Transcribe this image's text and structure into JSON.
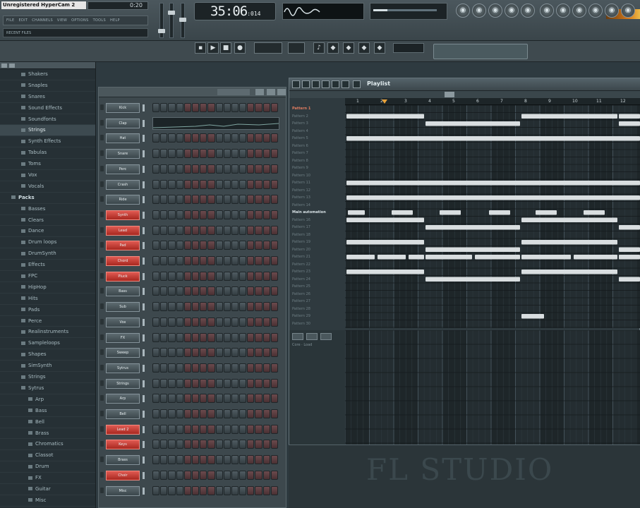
{
  "watermark": "Unregistered HyperCam 2",
  "topbar": {
    "song_number": "0:20",
    "menu": [
      "FILE",
      "EDIT",
      "CHANNELS",
      "VIEW",
      "OPTIONS",
      "TOOLS",
      "HELP"
    ],
    "hint": "RECENT FILES",
    "time": {
      "main": "35:06",
      "sub": ":014"
    }
  },
  "browser": {
    "items": [
      {
        "label": "Shakers",
        "level": 1
      },
      {
        "label": "Snaples",
        "level": 1
      },
      {
        "label": "Snares",
        "level": 1
      },
      {
        "label": "Sound Effects",
        "level": 1
      },
      {
        "label": "Soundfonts",
        "level": 1
      },
      {
        "label": "Strings",
        "level": 1,
        "selected": true
      },
      {
        "label": "Synth Effects",
        "level": 1
      },
      {
        "label": "Tabulas",
        "level": 1
      },
      {
        "label": "Toms",
        "level": 1
      },
      {
        "label": "Vox",
        "level": 1
      },
      {
        "label": "Vocals",
        "level": 1
      },
      {
        "label": "Packs",
        "level": 0
      },
      {
        "label": "Basses",
        "level": 1
      },
      {
        "label": "Clears",
        "level": 1
      },
      {
        "label": "Dance",
        "level": 1
      },
      {
        "label": "Drum loops",
        "level": 1
      },
      {
        "label": "DrumSynth",
        "level": 1
      },
      {
        "label": "Effects",
        "level": 1
      },
      {
        "label": "FPC",
        "level": 1
      },
      {
        "label": "HipHop",
        "level": 1
      },
      {
        "label": "Hits",
        "level": 1
      },
      {
        "label": "Pads",
        "level": 1
      },
      {
        "label": "Perce",
        "level": 1
      },
      {
        "label": "Realinstruments",
        "level": 1
      },
      {
        "label": "Sampleloops",
        "level": 1
      },
      {
        "label": "Shapes",
        "level": 1
      },
      {
        "label": "SimSynth",
        "level": 1
      },
      {
        "label": "Strings",
        "level": 1
      },
      {
        "label": "Sytrus",
        "level": 1
      },
      {
        "label": "Arp",
        "level": 2
      },
      {
        "label": "Bass",
        "level": 2
      },
      {
        "label": "Bell",
        "level": 2
      },
      {
        "label": "Brass",
        "level": 2
      },
      {
        "label": "Chromatics",
        "level": 2
      },
      {
        "label": "Classot",
        "level": 2
      },
      {
        "label": "Drum",
        "level": 2
      },
      {
        "label": "FX",
        "level": 2
      },
      {
        "label": "Guitar",
        "level": 2
      },
      {
        "label": "Misc",
        "level": 2
      }
    ]
  },
  "steps": {
    "channels": [
      {
        "label": "Kick",
        "red": false
      },
      {
        "label": "Clap",
        "red": false,
        "graph": true
      },
      {
        "label": "Hat",
        "red": false
      },
      {
        "label": "Snare",
        "red": false
      },
      {
        "label": "Perc",
        "red": false
      },
      {
        "label": "Crash",
        "red": false
      },
      {
        "label": "Ride",
        "red": false
      },
      {
        "label": "Synth",
        "red": true
      },
      {
        "label": "Lead",
        "red": true
      },
      {
        "label": "Pad",
        "red": true
      },
      {
        "label": "Chord",
        "red": true
      },
      {
        "label": "Pluck",
        "red": true
      },
      {
        "label": "Bass",
        "red": false
      },
      {
        "label": "Sub",
        "red": false
      },
      {
        "label": "Vox",
        "red": false
      },
      {
        "label": "FX",
        "red": false
      },
      {
        "label": "Sweep",
        "red": false
      },
      {
        "label": "Sytrus",
        "red": false
      },
      {
        "label": "Strings",
        "red": false
      },
      {
        "label": "Arp",
        "red": false
      },
      {
        "label": "Bell",
        "red": false
      },
      {
        "label": "Lead 2",
        "red": true
      },
      {
        "label": "Keys",
        "red": true
      },
      {
        "label": "Brass",
        "red": false
      },
      {
        "label": "Choir",
        "red": true
      },
      {
        "label": "Misc",
        "red": false
      }
    ]
  },
  "playlist": {
    "title": "Playlist",
    "ruler": [
      "1",
      "2",
      "3",
      "4",
      "5",
      "6",
      "7",
      "8",
      "9",
      "10",
      "11",
      "12"
    ],
    "tracks": [
      {
        "label": "Pattern 1",
        "style": "hi"
      },
      {
        "label": "Pattern 2"
      },
      {
        "label": "Pattern 3"
      },
      {
        "label": "Pattern 4"
      },
      {
        "label": "Pattern 5"
      },
      {
        "label": "Pattern 6"
      },
      {
        "label": "Pattern 7"
      },
      {
        "label": "Pattern 8"
      },
      {
        "label": "Pattern 9"
      },
      {
        "label": "Pattern 10"
      },
      {
        "label": "Pattern 11"
      },
      {
        "label": "Pattern 12"
      },
      {
        "label": "Pattern 13"
      },
      {
        "label": "Pattern 14"
      },
      {
        "label": "Main automation",
        "style": "w"
      },
      {
        "label": "Pattern 16"
      },
      {
        "label": "Pattern 17"
      },
      {
        "label": "Pattern 18"
      },
      {
        "label": "Pattern 19"
      },
      {
        "label": "Pattern 20"
      },
      {
        "label": "Pattern 21"
      },
      {
        "label": "Pattern 22"
      },
      {
        "label": "Pattern 23"
      },
      {
        "label": "Pattern 24"
      },
      {
        "label": "Pattern 25"
      },
      {
        "label": "Pattern 26"
      },
      {
        "label": "Pattern 27"
      },
      {
        "label": "Pattern 28"
      },
      {
        "label": "Pattern 29"
      },
      {
        "label": "Pattern 30"
      }
    ],
    "lower_label": "Core · Load",
    "logo": "FL STUDIO"
  },
  "colors": {
    "clip": "#d9dee0",
    "accent_red": "#d13a30",
    "accent_orange": "#e07c60"
  }
}
